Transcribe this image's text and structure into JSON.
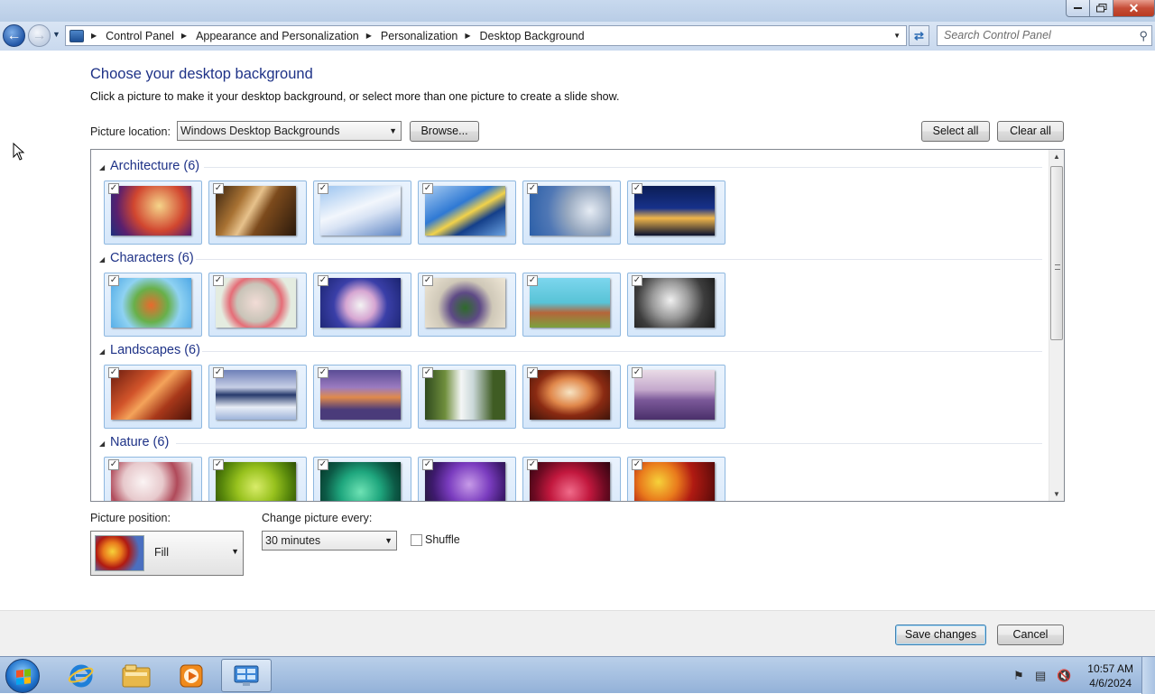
{
  "window": {
    "close_glyph": "✕"
  },
  "address_bar": {
    "breadcrumbs": [
      "Control Panel",
      "Appearance and Personalization",
      "Personalization",
      "Desktop Background"
    ]
  },
  "search": {
    "placeholder": "Search Control Panel"
  },
  "page": {
    "title": "Choose your desktop background",
    "description": "Click a picture to make it your desktop background, or select more than one picture to create a slide show."
  },
  "picture_location": {
    "label": "Picture location:",
    "value": "Windows Desktop Backgrounds",
    "browse_label": "Browse...",
    "select_all_label": "Select all",
    "clear_all_label": "Clear all"
  },
  "groups": [
    {
      "title": "Architecture (6)"
    },
    {
      "title": "Characters (6)"
    },
    {
      "title": "Landscapes (6)"
    },
    {
      "title": "Nature (6)"
    }
  ],
  "picture_position": {
    "label": "Picture position:",
    "value": "Fill"
  },
  "change_picture": {
    "label": "Change picture every:",
    "value": "30 minutes"
  },
  "shuffle": {
    "label": "Shuffle",
    "checked": false
  },
  "footer": {
    "save_label": "Save changes",
    "cancel_label": "Cancel"
  },
  "taskbar": {
    "time": "10:57 AM",
    "date": "4/6/2024"
  },
  "icons": {
    "back": "arrow-left-icon",
    "forward": "arrow-right-icon",
    "refresh": "refresh-icon",
    "search": "search-icon",
    "flag": "action-center-flag-icon",
    "network": "network-icon",
    "volume": "volume-muted-icon"
  },
  "colors": {
    "accent_title": "#1e3287",
    "selection_border": "#8fb8e0"
  }
}
